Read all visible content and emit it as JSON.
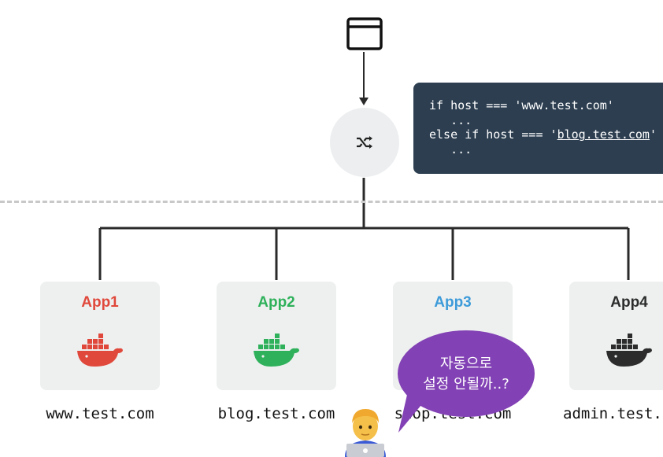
{
  "code": {
    "line1": "if host === 'www.test.com'",
    "line2": "   ...",
    "line3_prefix": "else if host === '",
    "line3_link": "blog.test.com",
    "line3_suffix": "'",
    "line4": "   ..."
  },
  "apps": [
    {
      "name": "App1",
      "color": "#e0483b",
      "domain": "www.test.com"
    },
    {
      "name": "App2",
      "color": "#2eb15a",
      "domain": "blog.test.com"
    },
    {
      "name": "App3",
      "color": "#3d9bd9",
      "domain": "shop.test.com"
    },
    {
      "name": "App4",
      "color": "#2c2c2c",
      "domain": "admin.test.com"
    }
  ],
  "bubble": {
    "line1": "자동으로",
    "line2": "설정 안될까..?",
    "color": "#8241b4"
  },
  "icons": {
    "browser": "browser-window-icon",
    "load_balancer": "shuffle-icon",
    "container": "docker-whale-icon",
    "user": "man-with-laptop-icon"
  }
}
